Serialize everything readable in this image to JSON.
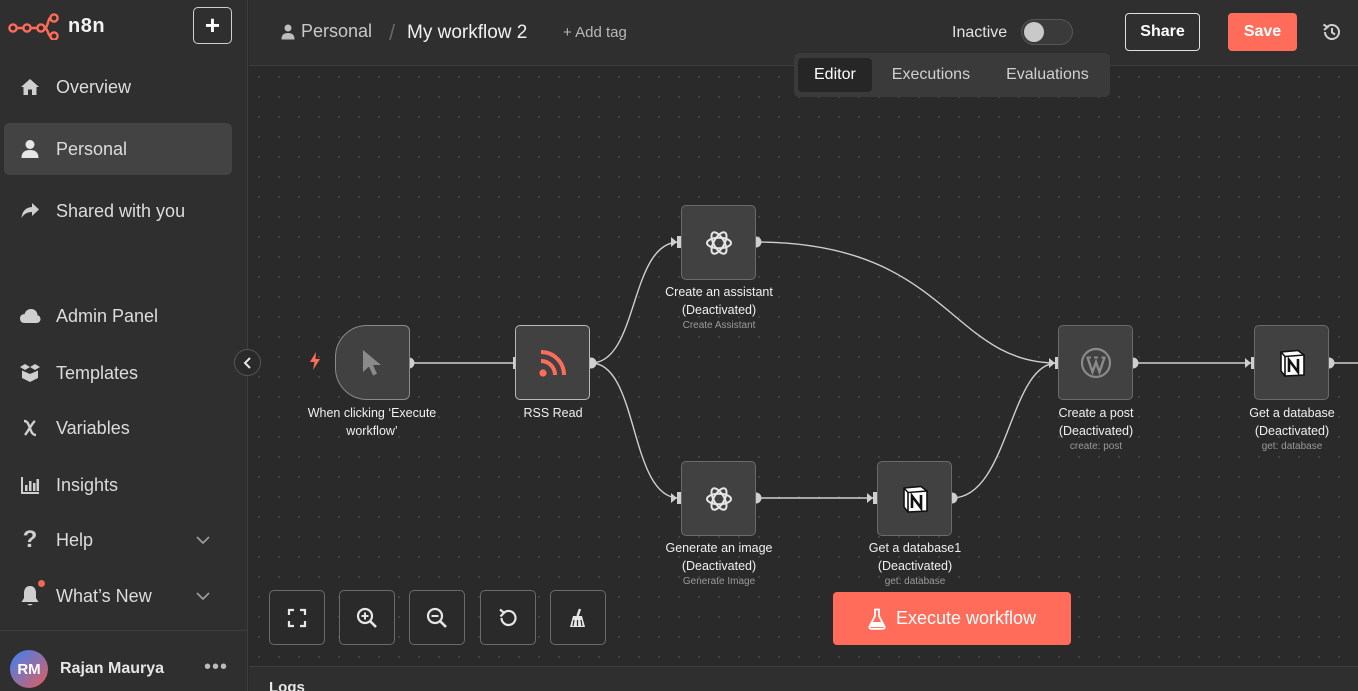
{
  "app": {
    "name": "n8n",
    "brand_color": "#ff6d5a"
  },
  "sidebar": {
    "new_button": "+",
    "items": [
      {
        "label": "Overview",
        "icon": "home-icon"
      },
      {
        "label": "Personal",
        "icon": "user-icon",
        "active": true
      },
      {
        "label": "Shared with you",
        "icon": "share-icon"
      },
      {
        "label": "Admin Panel",
        "icon": "cloud-icon"
      },
      {
        "label": "Templates",
        "icon": "box-icon"
      },
      {
        "label": "Variables",
        "icon": "variable-icon"
      },
      {
        "label": "Insights",
        "icon": "chart-icon"
      },
      {
        "label": "Help",
        "icon": "question-icon"
      },
      {
        "label": "What’s New",
        "icon": "bell-icon"
      }
    ],
    "user": {
      "initials": "RM",
      "name": "Rajan Maurya",
      "more": "•••"
    }
  },
  "header": {
    "project": "Personal",
    "separator": "/",
    "workflow_title": "My workflow 2",
    "add_tag": "+ Add tag",
    "status_label": "Inactive",
    "active": false,
    "share_label": "Share",
    "save_label": "Save"
  },
  "tabs": [
    {
      "label": "Editor",
      "active": true
    },
    {
      "label": "Executions"
    },
    {
      "label": "Evaluations"
    }
  ],
  "nodes": [
    {
      "id": "trigger",
      "label": "When clicking ‘Execute workflow’",
      "sub": "",
      "icon": "cursor-icon"
    },
    {
      "id": "rss",
      "label": "RSS Read",
      "sub": "",
      "icon": "rss-icon"
    },
    {
      "id": "assistant",
      "label": "Create an assistant",
      "label2": "(Deactivated)",
      "sub": "Create Assistant",
      "icon": "openai-icon"
    },
    {
      "id": "image",
      "label": "Generate an image",
      "label2": "(Deactivated)",
      "sub": "Generate Image",
      "icon": "openai-icon"
    },
    {
      "id": "db1",
      "label": "Get a database1",
      "label2": "(Deactivated)",
      "sub": "get: database",
      "icon": "notion-icon"
    },
    {
      "id": "post",
      "label": "Create a post",
      "label2": "(Deactivated)",
      "sub": "create: post",
      "icon": "wordpress-icon"
    },
    {
      "id": "db",
      "label": "Get a database",
      "label2": "(Deactivated)",
      "sub": "get: database",
      "icon": "notion-icon"
    }
  ],
  "execute_button": "Execute workflow",
  "logs_label": "Logs"
}
